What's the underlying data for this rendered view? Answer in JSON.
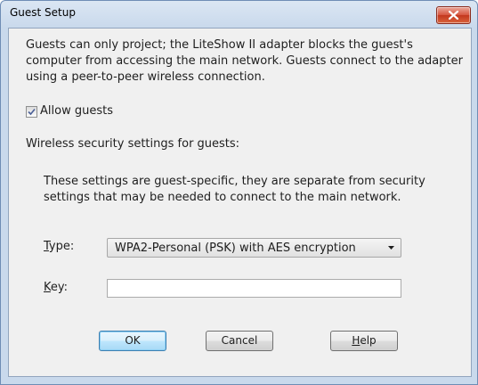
{
  "window": {
    "title": "Guest Setup",
    "close_icon": "close-x-icon"
  },
  "intro": {
    "line1": "Guests can only project; the LiteShow II adapter blocks the guest's",
    "line2": "computer from accessing the main network. Guests connect to the adapter",
    "line3": "using a peer-to-peer wireless connection."
  },
  "allow_guests": {
    "label": "Allow guests",
    "checked": true
  },
  "security": {
    "heading": "Wireless security settings for guests:",
    "note_line1": "These settings are guest-specific, they are separate from security",
    "note_line2": "settings that may be needed to connect to the main network."
  },
  "type_field": {
    "label_mnemonic": "T",
    "label_rest": "ype:",
    "value": "WPA2-Personal (PSK) with AES encryption"
  },
  "key_field": {
    "label_mnemonic": "K",
    "label_rest": "ey:",
    "value": ""
  },
  "buttons": {
    "ok": "OK",
    "cancel": "Cancel",
    "help_mnemonic": "H",
    "help_rest": "elp"
  },
  "colors": {
    "title_bar": "#c9d9ec",
    "client_bg": "#f0f0f0",
    "close_button": "#c3371f",
    "default_button": "#bee6fd"
  }
}
